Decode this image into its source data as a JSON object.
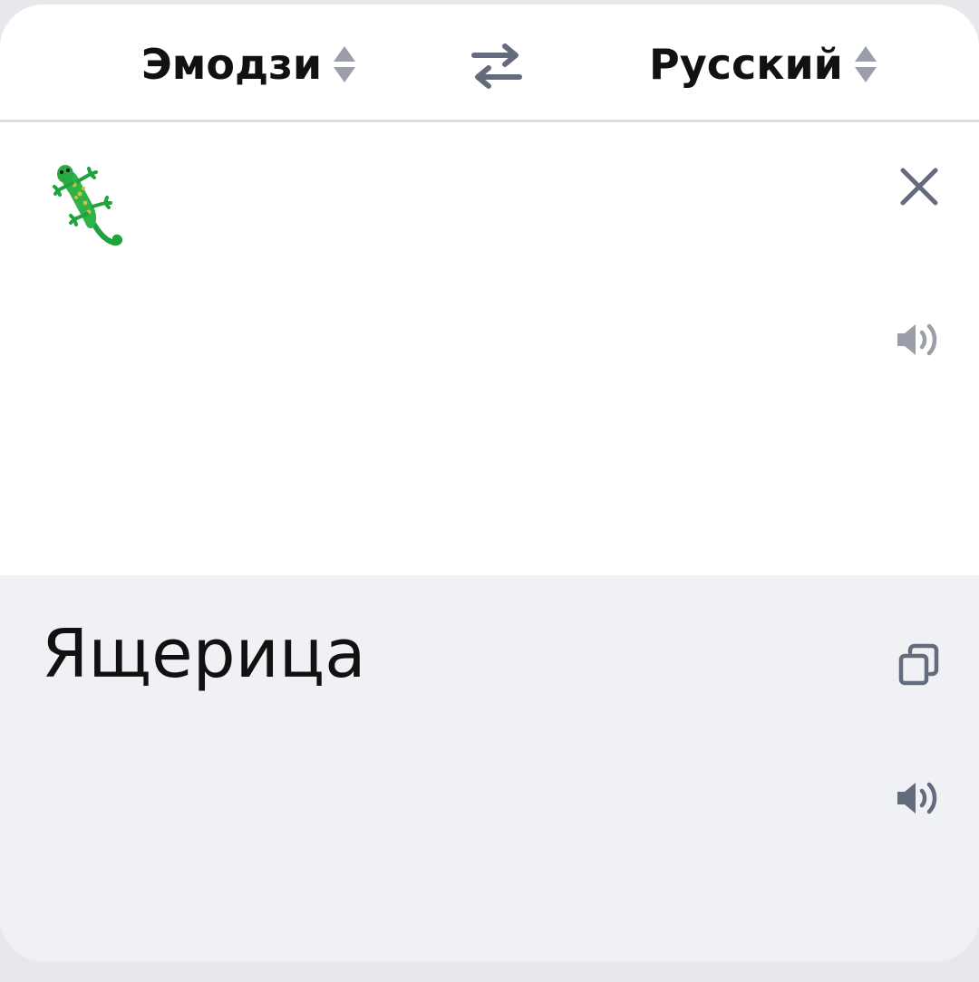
{
  "header": {
    "source_language": "Эмодзи",
    "target_language": "Русский",
    "swap_icon": "swap-arrows-icon"
  },
  "input": {
    "text": "🦎",
    "emoji_icon": "lizard-emoji"
  },
  "output": {
    "text": "Ящерица"
  },
  "colors": {
    "icon_gray": "#646b7d",
    "sort_gray": "#9a9ea8",
    "output_bg": "#f0f1f5",
    "divider": "#dcdde2"
  }
}
